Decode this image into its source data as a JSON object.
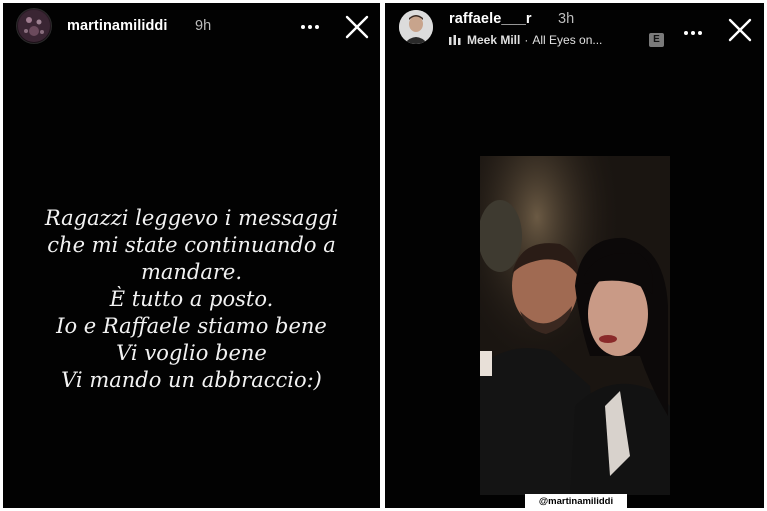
{
  "left_story": {
    "username": "martinamiliddi",
    "time": "9h",
    "lines": [
      "Ragazzi leggevo i messaggi",
      "che mi state continuando a",
      "mandare.",
      "È tutto a posto.",
      "Io e Raffaele stiamo bene",
      "Vi voglio bene",
      "Vi mando un abbraccio:)"
    ]
  },
  "right_story": {
    "username": "raffaele___r",
    "time": "3h",
    "music": {
      "artist": "Meek Mill",
      "separator": "·",
      "track": "All Eyes on..."
    },
    "explicit_badge": "E",
    "mention": "@martinamiliddi"
  },
  "icons": {
    "more": "more-horizontal-icon",
    "close": "close-icon",
    "music": "music-bars-icon"
  },
  "colors": {
    "background": "#020202",
    "text": "#ffffff",
    "muted_text": "#bdbdbd"
  }
}
